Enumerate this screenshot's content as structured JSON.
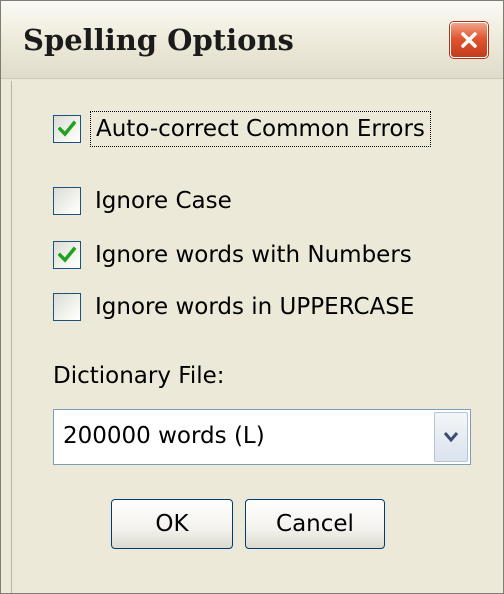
{
  "window": {
    "title": "Spelling Options"
  },
  "options": [
    {
      "label": "Auto-correct Common Errors",
      "checked": true
    },
    {
      "label": "Ignore Case",
      "checked": false
    },
    {
      "label": "Ignore words with Numbers",
      "checked": true
    },
    {
      "label": "Ignore words in UPPERCASE",
      "checked": false
    }
  ],
  "dictionary": {
    "label": "Dictionary File:",
    "selected": "200000 words (L)"
  },
  "buttons": {
    "ok_label": "OK",
    "cancel_label": "Cancel"
  },
  "colors": {
    "check": "#21a121",
    "checkbox_border": "#1c5180",
    "dialog_background": "#ece9d8",
    "close_button": "#e0562f"
  },
  "icons": {
    "close": "close-icon",
    "check": "checkmark-icon",
    "dropdown": "chevron-down-icon"
  }
}
